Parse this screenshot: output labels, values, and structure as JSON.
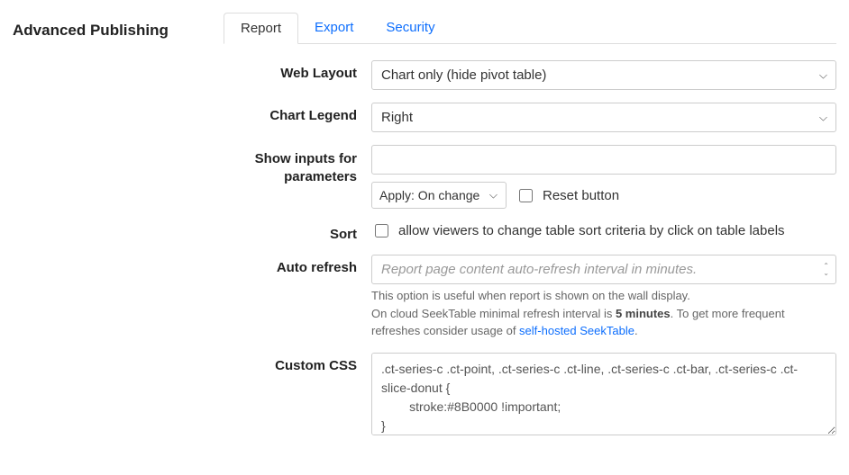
{
  "section_title": "Advanced Publishing",
  "tabs": {
    "report": "Report",
    "export": "Export",
    "security": "Security"
  },
  "web_layout": {
    "label": "Web Layout",
    "value": "Chart only (hide pivot table)"
  },
  "chart_legend": {
    "label": "Chart Legend",
    "value": "Right"
  },
  "show_inputs": {
    "label_line1": "Show inputs for",
    "label_line2": "parameters",
    "text_value": "",
    "apply_value": "Apply: On change",
    "reset_label": "Reset button"
  },
  "sort": {
    "label": "Sort",
    "checkbox_label": "allow viewers to change table sort criteria by click on table labels"
  },
  "auto_refresh": {
    "label": "Auto refresh",
    "placeholder": "Report page content auto-refresh interval in minutes.",
    "help_line1": "This option is useful when report is shown on the wall display.",
    "help_line2_a": "On cloud SeekTable minimal refresh interval is ",
    "help_line2_b": "5 minutes",
    "help_line2_c": ". To get more frequent refreshes consider usage of ",
    "help_link": "self-hosted SeekTable",
    "help_line2_d": "."
  },
  "custom_css": {
    "label": "Custom CSS",
    "value": ".ct-series-c .ct-point, .ct-series-c .ct-line, .ct-series-c .ct-bar, .ct-series-c .ct-slice-donut {\n        stroke:#8B0000 !important;\n}"
  }
}
